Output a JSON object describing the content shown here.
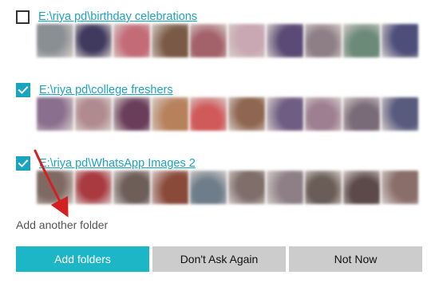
{
  "folders": [
    {
      "checked": false,
      "path": "E:\\riya pd\\birthday celebrations",
      "thumb_colors": [
        "#8a8f94",
        "#3f3a5e",
        "#c46b78",
        "#7a5a46",
        "#a3616a",
        "#c9a7b3",
        "#5b4a75",
        "#8e7e86",
        "#6c8a78",
        "#4d4f7a"
      ]
    },
    {
      "checked": true,
      "path": "E:\\riya pd\\college freshers",
      "thumb_colors": [
        "#8a6f8e",
        "#b08a8e",
        "#6a3e5a",
        "#b7815c",
        "#d05a5a",
        "#8f6650",
        "#6f5d83",
        "#9e7e91",
        "#7a6b78",
        "#585a7e"
      ]
    },
    {
      "checked": true,
      "path": "E:\\riya pd\\WhatsApp Images 2",
      "thumb_colors": [
        "#7e6a62",
        "#a83a40",
        "#6e5e58",
        "#8a4a3a",
        "#6f7d8a",
        "#7f6e6a",
        "#8e7f86",
        "#6a5c56",
        "#5c4a4a",
        "#8a6e6a"
      ]
    }
  ],
  "add_another_label": "Add another folder",
  "buttons": {
    "add_folders": "Add folders",
    "dont_ask": "Don't Ask Again",
    "not_now": "Not Now"
  },
  "colors": {
    "accent": "#1aa4c0",
    "primary_button": "#1db6c6",
    "secondary_button": "#cccccc",
    "annotation_arrow": "#d32020"
  },
  "annotation": {
    "type": "red-arrow",
    "points_to": "add-another-folder"
  }
}
